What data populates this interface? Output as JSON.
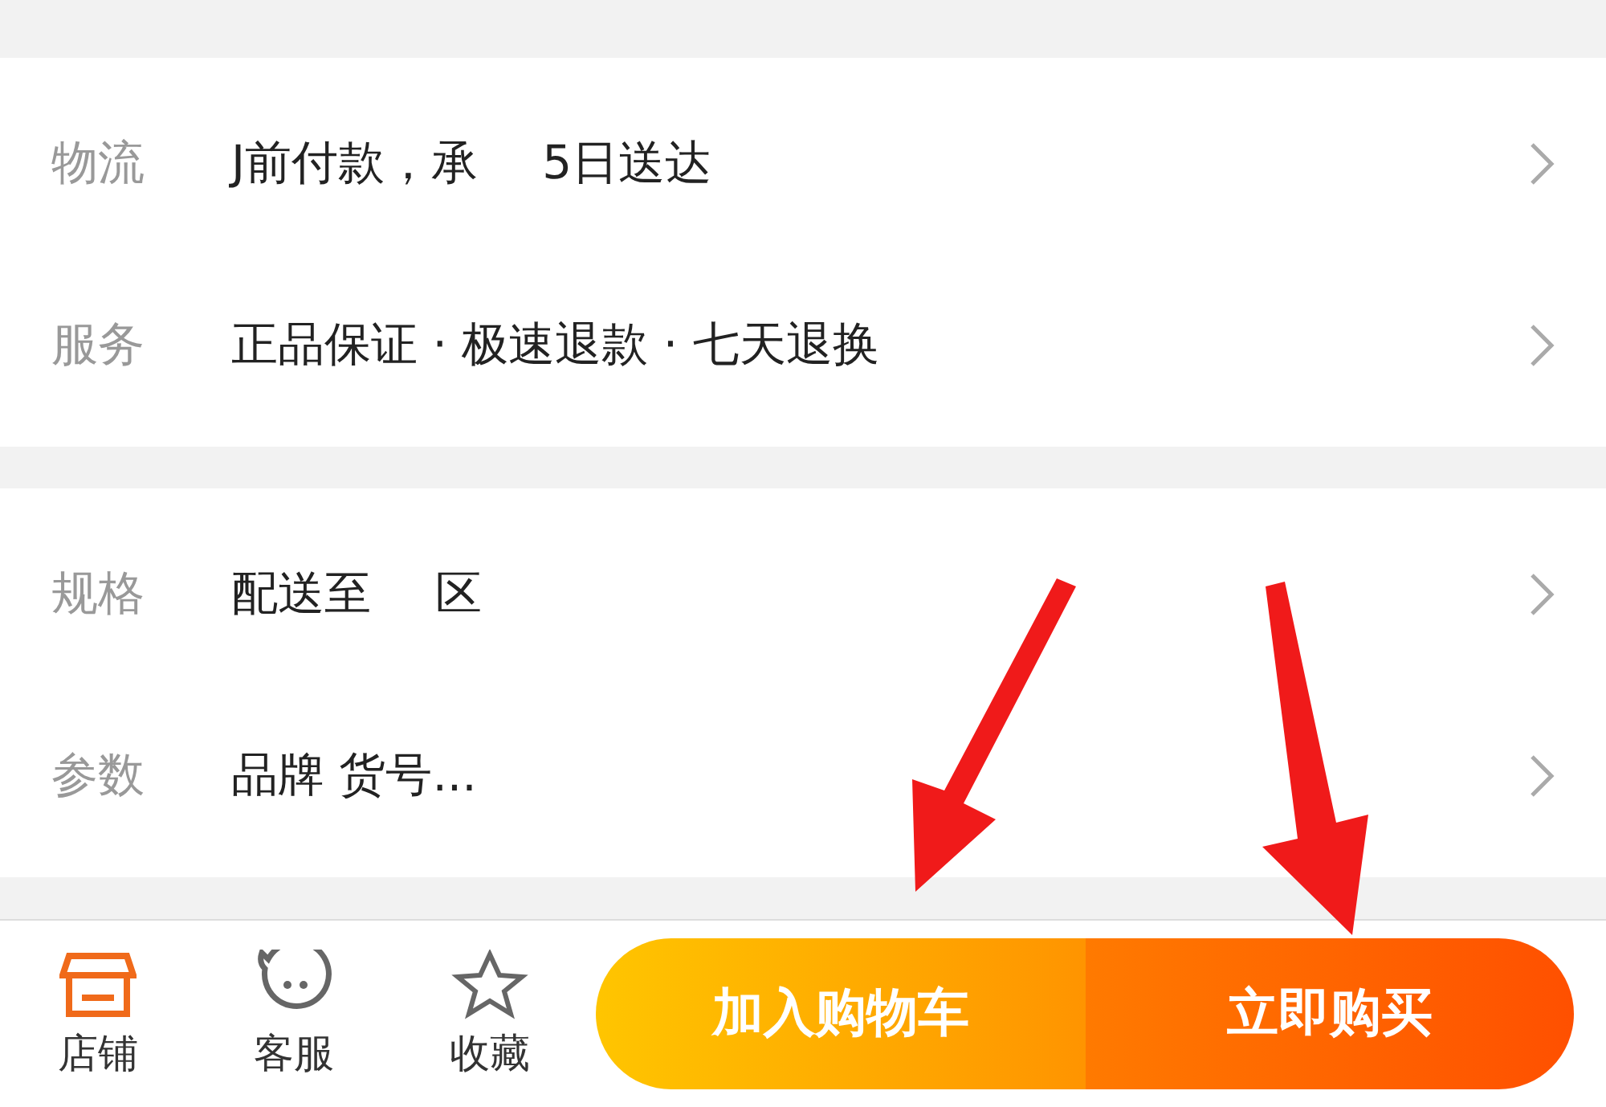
{
  "sections": [
    {
      "rows": [
        {
          "label": "物流",
          "value_parts": [
            "J前付款，承",
            "5日送达"
          ]
        },
        {
          "label": "服务",
          "value_parts": [
            "正品保证 · 极速退款 · 七天退换"
          ]
        }
      ]
    },
    {
      "rows": [
        {
          "label": "规格",
          "value_parts": [
            "配送至",
            "区"
          ]
        },
        {
          "label": "参数",
          "value_parts": [
            "品牌 货号..."
          ]
        }
      ]
    }
  ],
  "bottom_bar": {
    "icons": [
      {
        "kind": "shop",
        "label": "店铺",
        "selected": true
      },
      {
        "kind": "service",
        "label": "客服",
        "selected": false
      },
      {
        "kind": "favorite",
        "label": "收藏",
        "selected": false
      }
    ],
    "cart_button": "加入购物车",
    "buy_button": "立即购买"
  }
}
